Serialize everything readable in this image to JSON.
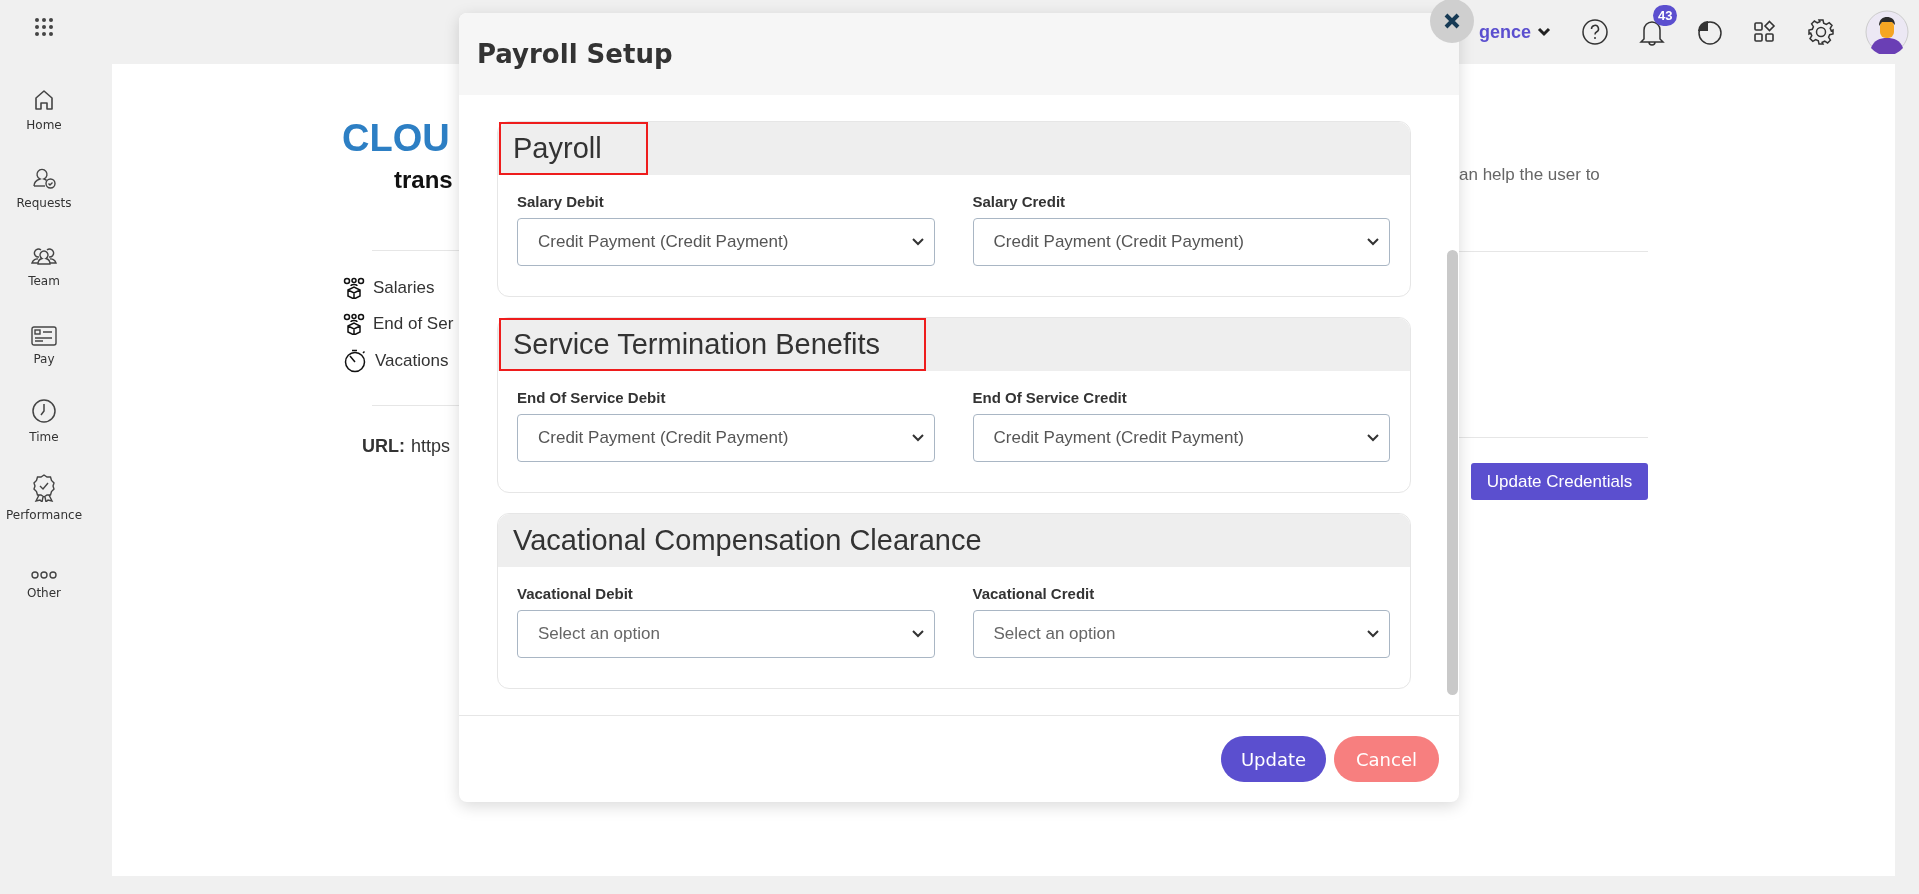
{
  "topbar": {
    "org_label": "gence",
    "notification_count": "43"
  },
  "sidebar": {
    "items": [
      {
        "label": "Home"
      },
      {
        "label": "Requests"
      },
      {
        "label": "Team"
      },
      {
        "label": "Pay"
      },
      {
        "label": "Time"
      },
      {
        "label": "Performance"
      },
      {
        "label": "Other"
      }
    ]
  },
  "background": {
    "logo_top": "CLOU",
    "logo_bottom": "trans",
    "description": "an help the user to",
    "items": [
      {
        "label": "Salaries"
      },
      {
        "label": "End of Ser"
      },
      {
        "label": "Vacations"
      }
    ],
    "url_label": "URL:",
    "url_value": "https",
    "update_button": "Update Credentials"
  },
  "modal": {
    "title": "Payroll Setup",
    "sections": [
      {
        "title": "Payroll",
        "highlighted": true,
        "fields": [
          {
            "label": "Salary Debit",
            "value": "Credit Payment (Credit Payment)"
          },
          {
            "label": "Salary Credit",
            "value": "Credit Payment (Credit Payment)"
          }
        ]
      },
      {
        "title": "Service Termination Benefits",
        "highlighted": true,
        "fields": [
          {
            "label": "End Of Service Debit",
            "value": "Credit Payment (Credit Payment)"
          },
          {
            "label": "End Of Service Credit",
            "value": "Credit Payment (Credit Payment)"
          }
        ]
      },
      {
        "title": "Vacational Compensation Clearance",
        "highlighted": false,
        "fields": [
          {
            "label": "Vacational Debit",
            "placeholder": "Select an option"
          },
          {
            "label": "Vacational Credit",
            "placeholder": "Select an option"
          }
        ]
      }
    ],
    "buttons": [
      {
        "label": "Update",
        "kind": "primary"
      },
      {
        "label": "Cancel",
        "kind": "danger"
      }
    ]
  }
}
